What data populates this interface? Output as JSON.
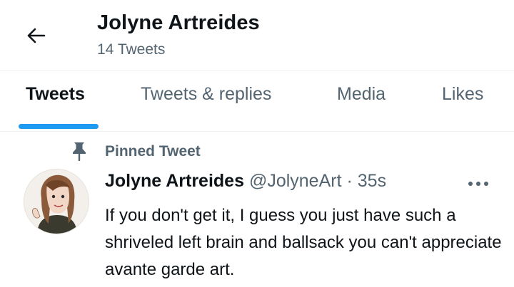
{
  "header": {
    "title": "Jolyne Artreides",
    "subtitle": "14 Tweets"
  },
  "tabs": [
    {
      "label": "Tweets",
      "active": true
    },
    {
      "label": "Tweets & replies",
      "active": false
    },
    {
      "label": "Media",
      "active": false
    },
    {
      "label": "Likes",
      "active": false
    }
  ],
  "pinned": {
    "label": "Pinned Tweet"
  },
  "tweet": {
    "name": "Jolyne Artreides",
    "handle": "@JolyneArt",
    "separator": "·",
    "time": "35s",
    "text": "If you don't get it, I guess you just have such a shriveled left brain and ballsack you can't appreciate avante garde art."
  },
  "colors": {
    "accent": "#1d9bf0",
    "text_primary": "#0f1419",
    "text_secondary": "#536471",
    "divider": "#eff3f4"
  },
  "icons": {
    "back": "arrow-left-icon",
    "pin": "pin-icon",
    "more": "more-horizontal-icon"
  }
}
